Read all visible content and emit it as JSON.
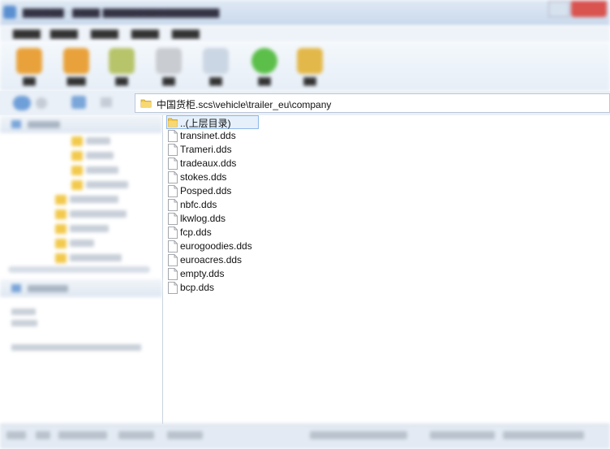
{
  "colors": {
    "folder": "#f2c94c",
    "selection_bg": "#e5f0fb",
    "selection_border": "#8fb7e8",
    "close": "#d9534f"
  },
  "address_bar": {
    "path": "中国货柜.scs\\vehicle\\trailer_eu\\company"
  },
  "file_list": {
    "items": [
      {
        "name": "..(上层目录)",
        "icon": "folder-up-icon",
        "selected": true
      },
      {
        "name": "transinet.dds",
        "icon": "file-icon"
      },
      {
        "name": "Trameri.dds",
        "icon": "file-icon"
      },
      {
        "name": "tradeaux.dds",
        "icon": "file-icon"
      },
      {
        "name": "stokes.dds",
        "icon": "file-icon"
      },
      {
        "name": "Posped.dds",
        "icon": "file-icon"
      },
      {
        "name": "nbfc.dds",
        "icon": "file-icon"
      },
      {
        "name": "lkwlog.dds",
        "icon": "file-icon"
      },
      {
        "name": "fcp.dds",
        "icon": "file-icon"
      },
      {
        "name": "eurogoodies.dds",
        "icon": "file-icon"
      },
      {
        "name": "euroacres.dds",
        "icon": "file-icon"
      },
      {
        "name": "empty.dds",
        "icon": "file-icon"
      },
      {
        "name": "bcp.dds",
        "icon": "file-icon"
      }
    ]
  }
}
